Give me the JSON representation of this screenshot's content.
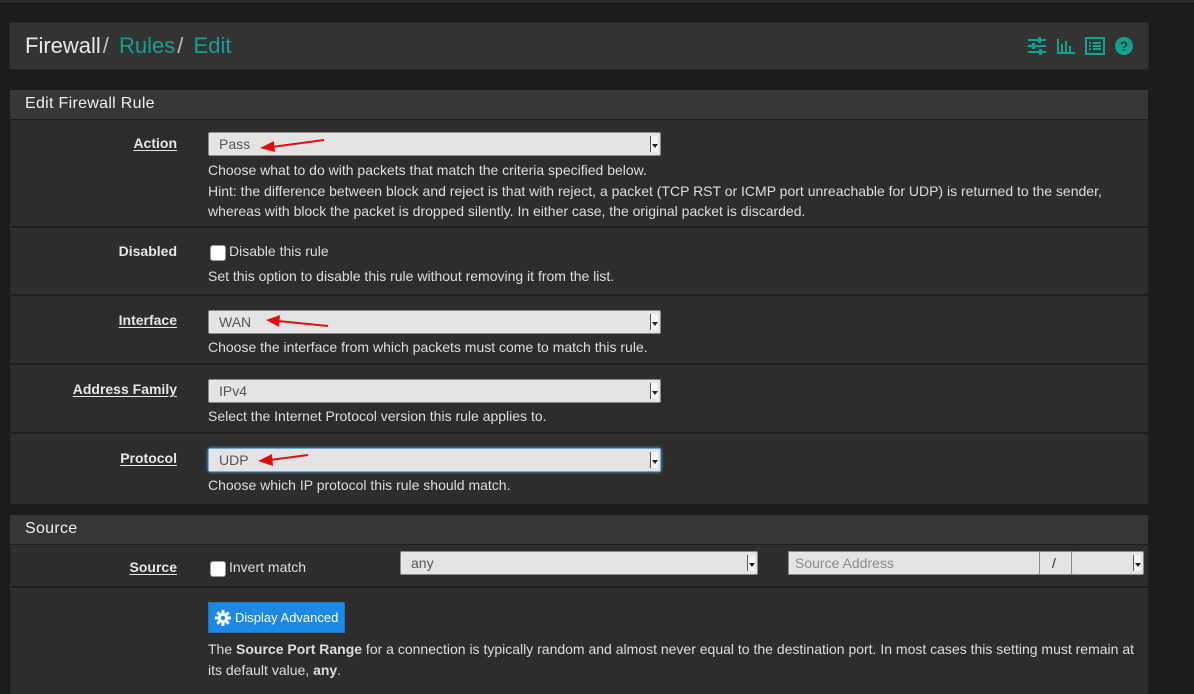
{
  "breadcrumb": {
    "root": "Firewall",
    "rules": "Rules",
    "edit": "Edit",
    "sep": "/"
  },
  "header_icons": [
    "sliders-icon",
    "bar-chart-icon",
    "list-icon",
    "help-icon"
  ],
  "accent_color": "#12a18f",
  "edit_panel": {
    "title": "Edit Firewall Rule",
    "action": {
      "label": "Action",
      "value": "Pass",
      "help1": "Choose what to do with packets that match the criteria specified below.",
      "help2": "Hint: the difference between block and reject is that with reject, a packet (TCP RST or ICMP port unreachable for UDP) is returned to the sender,",
      "help3": "whereas with block the packet is dropped silently. In either case, the original packet is discarded."
    },
    "disabled": {
      "label": "Disabled",
      "checkbox_label": "Disable this rule",
      "help": "Set this option to disable this rule without removing it from the list."
    },
    "interface": {
      "label": "Interface",
      "value": "WAN",
      "help": "Choose the interface from which packets must come to match this rule."
    },
    "address_family": {
      "label": "Address Family",
      "value": "IPv4",
      "help": "Select the Internet Protocol version this rule applies to."
    },
    "protocol": {
      "label": "Protocol",
      "value": "UDP",
      "help": "Choose which IP protocol this rule should match."
    }
  },
  "source_panel": {
    "title": "Source",
    "source": {
      "label": "Source",
      "invert_label": "Invert match",
      "type_value": "any",
      "address_placeholder": "Source Address",
      "slash": "/"
    },
    "advanced_button": "Display Advanced",
    "port_help": {
      "p1": "The ",
      "bold1": "Source Port Range",
      "p2": " for a connection is typically random and almost never equal to the destination port. In most cases this setting must remain at",
      "p3": "its default value, ",
      "bold2": "any",
      "p4": "."
    }
  }
}
